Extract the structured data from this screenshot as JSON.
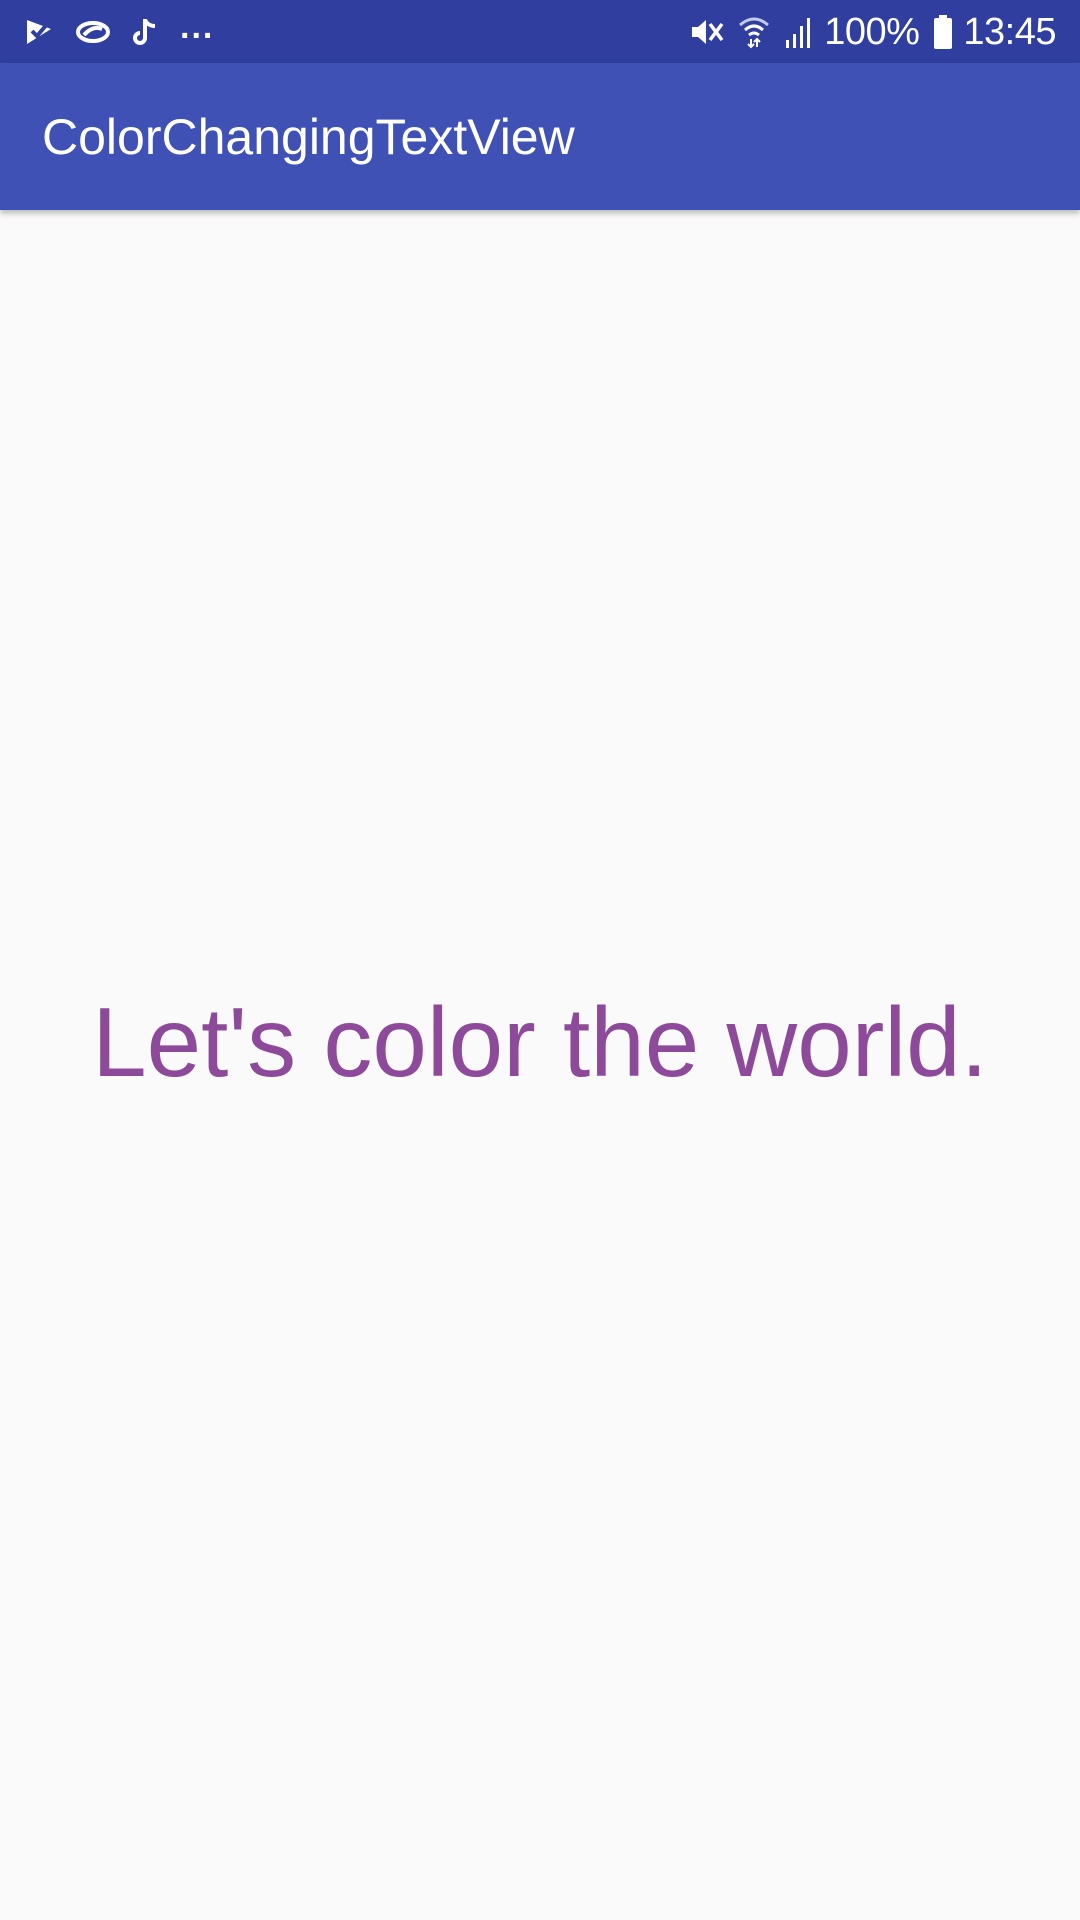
{
  "status_bar": {
    "left_icons": [
      "checkmark-app-icon",
      "cloud-app-icon",
      "tiktok-icon"
    ],
    "overflow": "...",
    "right_icons": [
      "mute-vibrate-icon",
      "wifi-icon",
      "signal-icon",
      "battery-icon"
    ],
    "battery": "100%",
    "time": "13:45"
  },
  "app_bar": {
    "title": "ColorChangingTextView",
    "color": "#3f51b5",
    "status_color": "#303f9f"
  },
  "content": {
    "text": "Let's color the world.",
    "text_color": "#8e4a9a",
    "background": "#fafafa"
  }
}
